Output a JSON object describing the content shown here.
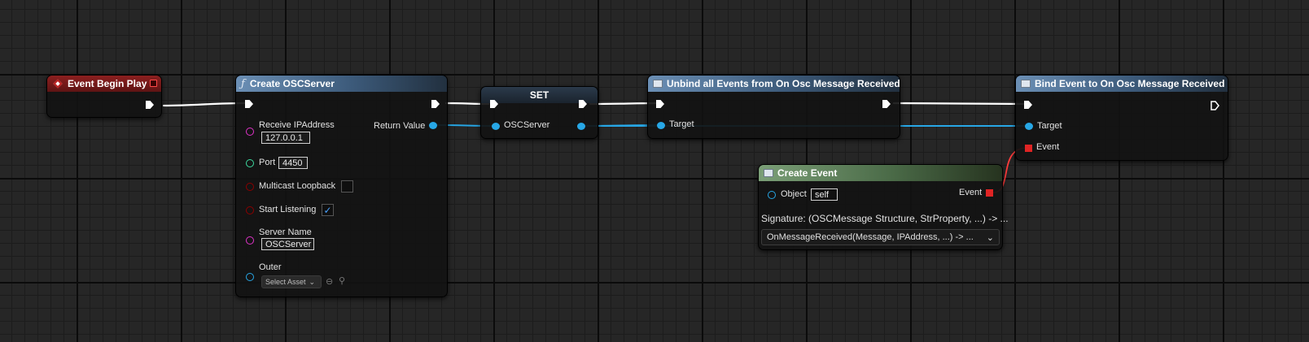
{
  "colors": {
    "canvas": "#262626",
    "exec_wire": "#ffffff",
    "object_wire": "#27a7e6",
    "delegate_wire": "#ff3b3b",
    "string_pin": "#e033c8",
    "integer_pin": "#3ddba0",
    "boolean_pin": "#8c0000"
  },
  "nodes": {
    "event_begin_play": {
      "title": "Event Begin Play",
      "icon": "event-diamond-icon"
    },
    "create_osc_server": {
      "title": "Create OSCServer",
      "icon": "function-icon",
      "return_label": "Return Value",
      "receive_ip_label": "Receive IPAddress",
      "receive_ip_value": "127.0.0.1",
      "port_label": "Port",
      "port_value": "4450",
      "multicast_label": "Multicast Loopback",
      "multicast_checked": false,
      "start_listening_label": "Start Listening",
      "start_listening_checked": true,
      "server_name_label": "Server Name",
      "server_name_value": "OSCServer",
      "outer_label": "Outer",
      "outer_select": "Select Asset"
    },
    "set_node": {
      "title": "SET",
      "pin_label": "OSCServer"
    },
    "unbind": {
      "title": "Unbind all Events from On Osc Message Received",
      "target_label": "Target"
    },
    "bind": {
      "title": "Bind Event to On Osc Message Received",
      "target_label": "Target",
      "event_label": "Event"
    },
    "create_event": {
      "title": "Create Event",
      "object_label": "Object",
      "object_value": "self",
      "event_label": "Event",
      "signature": "Signature: (OSCMessage Structure, StrProperty, ...) -> ...",
      "function_selected": "OnMessageReceived(Message, IPAddress, ...) -> ..."
    }
  }
}
